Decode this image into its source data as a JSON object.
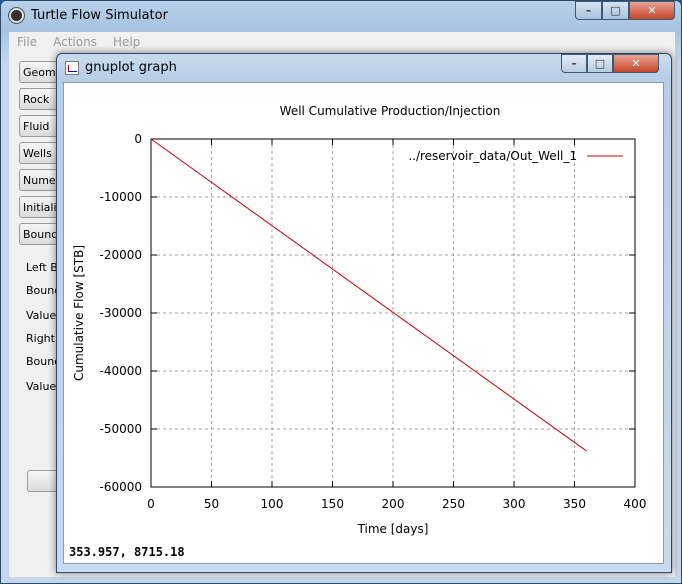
{
  "main_window": {
    "title": "Turtle Flow Simulator",
    "controls": {
      "minimize": "–",
      "maximize": "□",
      "close": "✕"
    }
  },
  "menu": [
    "File",
    "Actions",
    "Help"
  ],
  "sidebar": {
    "buttons": [
      "Geometry",
      "Rock",
      "Fluid",
      "Wells",
      "Numerical",
      "Initialization",
      "Boundary"
    ],
    "labels": [
      "Left Bo",
      "Bound",
      "Value:",
      "Right B",
      "Bound",
      "Value:"
    ]
  },
  "gnuplot_window": {
    "title": "gnuplot graph",
    "status": "353.957,  8715.18"
  },
  "chart_data": {
    "type": "line",
    "title": "Well Cumulative Production/Injection",
    "xlabel": "Time [days]",
    "ylabel": "Cumulative Flow [STB]",
    "xlim": [
      0,
      400
    ],
    "ylim": [
      -60000,
      0
    ],
    "x_ticks": [
      "0",
      "50",
      "100",
      "150",
      "200",
      "250",
      "300",
      "350",
      "400"
    ],
    "y_ticks": [
      "0",
      "-10000",
      "-20000",
      "-30000",
      "-40000",
      "-50000",
      "-60000"
    ],
    "grid": true,
    "legend_position": "top-right",
    "series": [
      {
        "name": "../reservoir_data/Out_Well_1",
        "color": "#cc0000",
        "x": [
          0,
          360
        ],
        "y": [
          0,
          -53800
        ]
      }
    ]
  }
}
